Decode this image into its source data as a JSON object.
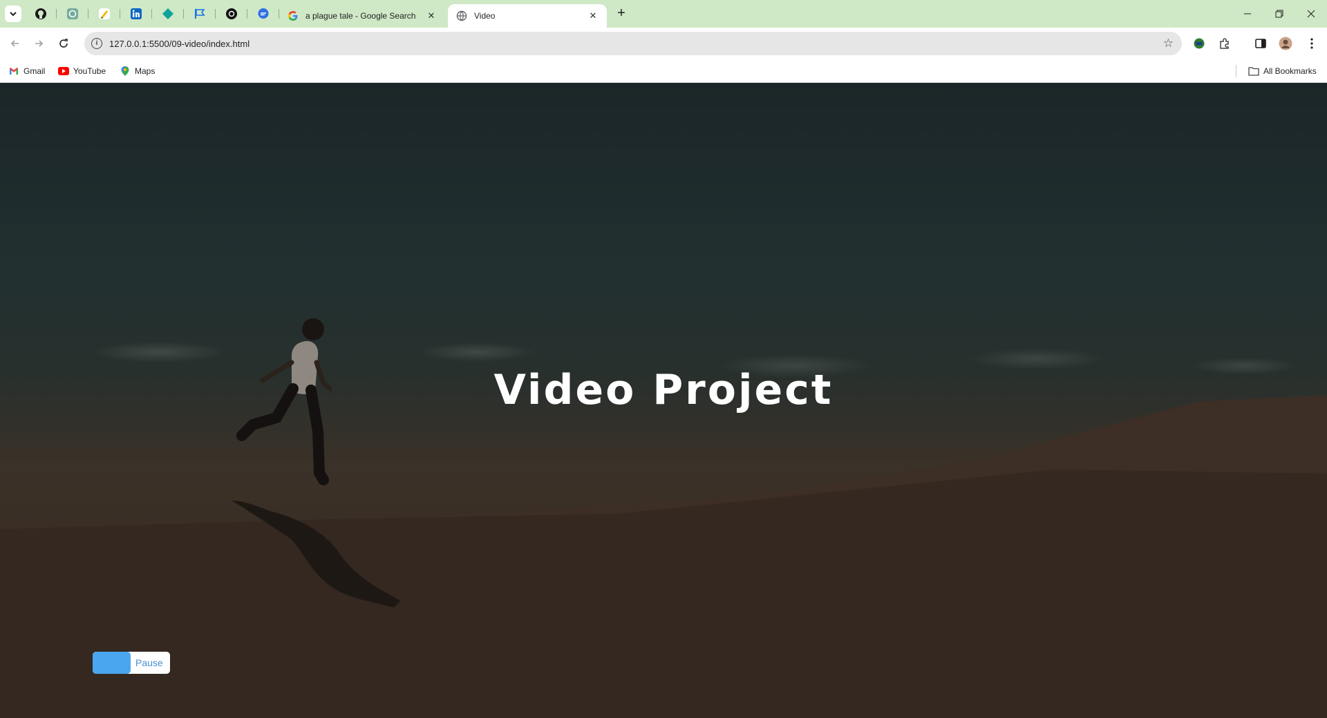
{
  "browser": {
    "tabs": [
      {
        "title": "a plague tale - Google Search"
      },
      {
        "title": "Video"
      }
    ],
    "pinned_tabs": [
      {
        "icon": "github-icon",
        "color": "#181717"
      },
      {
        "icon": "chatgpt-icon",
        "color": "#74aa9c"
      },
      {
        "icon": "pencil-app-icon",
        "color": "#f5b400"
      },
      {
        "icon": "linkedin-icon",
        "color": "#0a66c2"
      },
      {
        "icon": "diamond-app-icon",
        "color": "#0fa39a"
      },
      {
        "icon": "flag-app-icon",
        "color": "#1a73e8"
      },
      {
        "icon": "openai-icon",
        "color": "#111111"
      },
      {
        "icon": "chat-bubble-icon",
        "color": "#2f6ee4"
      }
    ],
    "url": "127.0.0.1:5500/09-video/index.html",
    "bookmarks": [
      {
        "label": "Gmail",
        "icon": "gmail-icon"
      },
      {
        "label": "YouTube",
        "icon": "youtube-icon"
      },
      {
        "label": "Maps",
        "icon": "maps-icon"
      }
    ],
    "all_bookmarks_label": "All Bookmarks"
  },
  "page": {
    "title": "Video Project",
    "video_button": {
      "label": "Pause",
      "accent": "#4aa6ee"
    }
  }
}
